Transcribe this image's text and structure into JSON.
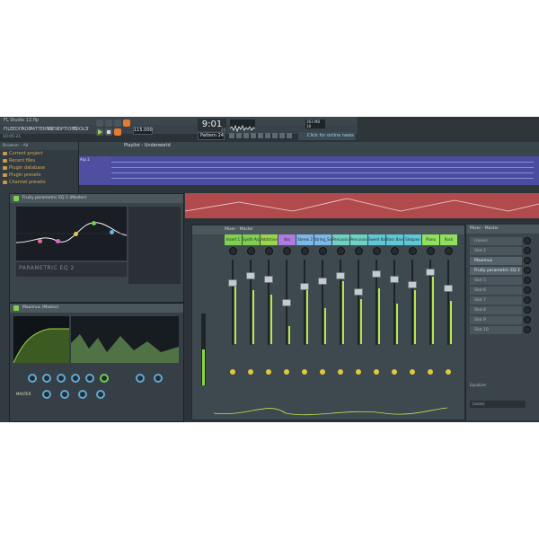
{
  "app": {
    "title": "FL Studio 12.flp"
  },
  "menu": [
    "FILE",
    "EDIT",
    "ADD",
    "PATTERNS",
    "VIEW",
    "OPTIONS",
    "TOOLS",
    "?"
  ],
  "hint": "10:05:21",
  "transport": {
    "tempo": "115.000",
    "time": "9:01",
    "time_sub": "24",
    "pattern": "Pattern 24"
  },
  "cpu": {
    "line1": "363 MB",
    "line2": "18"
  },
  "news": "Click for online news",
  "browser": {
    "header": "Browser - All",
    "items": [
      "Current project",
      "Recent files",
      "Plugin database",
      "Plugin presets",
      "Channel presets"
    ]
  },
  "playlist": {
    "title": "Playlist - Underworld",
    "track": "Arp 2"
  },
  "eq_window": {
    "title": "Fruity parametric EQ 2 (Master)",
    "logo": "PARAMETRIC EQ 2"
  },
  "max_window": {
    "title": "Maximus (Master)",
    "bottom_label": "MASTER"
  },
  "mixer": {
    "title": "Mixer - Master",
    "channels": [
      {
        "name": "Insert 1",
        "color": "#7fd14d"
      },
      {
        "name": "Synth Arp",
        "color": "#7fd14d"
      },
      {
        "name": "Addictive",
        "color": "#9ad64a"
      },
      {
        "name": "Voc",
        "color": "#b07be0"
      },
      {
        "name": "Stereo 2",
        "color": "#7bb8e8"
      },
      {
        "name": "String_Soo",
        "color": "#7bb8e8"
      },
      {
        "name": "Percussion",
        "color": "#6fd1c4"
      },
      {
        "name": "Percussion",
        "color": "#6fd1c4"
      },
      {
        "name": "Sweet Bass",
        "color": "#5fc8d8"
      },
      {
        "name": "Bass Bass",
        "color": "#5fc8d8"
      },
      {
        "name": "Steppen",
        "color": "#5fc8d8"
      },
      {
        "name": "Piano",
        "color": "#8fe05a"
      },
      {
        "name": "Rock",
        "color": "#8fe05a"
      }
    ]
  },
  "fx_panel": {
    "title": "Mixer - Master",
    "slots": [
      "(none)",
      "Slot 2",
      "Maximus",
      "Fruity parametric EQ 2",
      "Slot 5",
      "Slot 6",
      "Slot 7",
      "Slot 8",
      "Slot 9",
      "Slot 10"
    ],
    "eq_label": "Equalizer",
    "out": "(none)"
  }
}
